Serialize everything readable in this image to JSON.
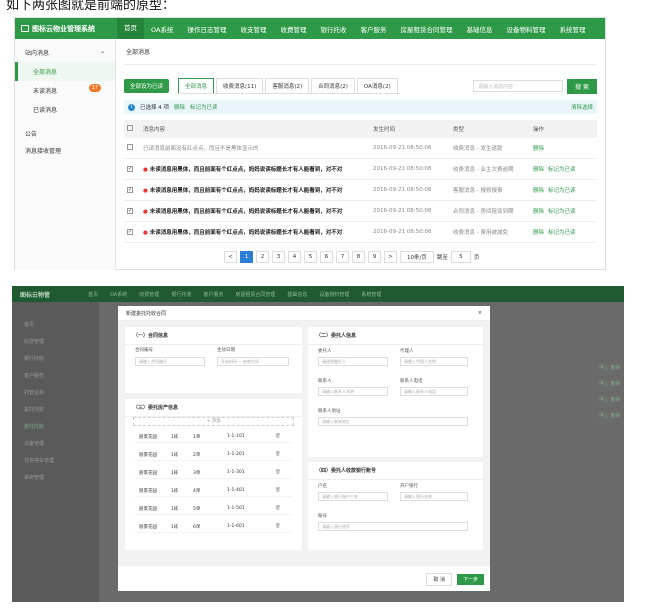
{
  "caption": "如下两张图就是前端的原型：",
  "top": {
    "brand": "图标云物业管理系统",
    "nav": [
      "首页",
      "OA系统",
      "操作日志管理",
      "收支管理",
      "收费管理",
      "银行托收",
      "客户服务",
      "房屋租赁合同管理",
      "基础信息",
      "设备物料管理",
      "系统管理"
    ],
    "sidebar": {
      "group1": "站内消息",
      "items": [
        {
          "label": "全部消息"
        },
        {
          "label": "未读消息",
          "badge": "17"
        },
        {
          "label": "已读消息"
        }
      ],
      "group2": "公告",
      "group3": "消息接收管理"
    },
    "breadcrumb": "全部消息",
    "mark_all_read": "全部设为已读",
    "tabs": [
      "全部消息",
      "收费消息(11)",
      "客服消息(2)",
      "合同消息(2)",
      "OA消息(2)"
    ],
    "search_placeholder": "请输入消息内容",
    "search_button": "搜 索",
    "info": {
      "selected": "已选择 4 项",
      "delete": "删除",
      "mark_read": "标记为已读",
      "clear": "清除选择"
    },
    "columns": [
      "消息内容",
      "发生时间",
      "类型",
      "操作"
    ],
    "rows": [
      {
        "content": "已读消息前面没有红点点，而且不是黑体显示的",
        "time": "2016-09-21  08:50:08",
        "type": "收费消息 - 发生退款",
        "ops": [
          "删除"
        ],
        "read": true,
        "checked": false
      },
      {
        "content": "未读消息用黑体，而且前面有个红点点，妈妈说读标题长才有人能看到，对不对",
        "time": "2016-09-21  08:50:08",
        "type": "收费消息 - 业主欠费逾期",
        "ops": [
          "删除",
          "标记为已读"
        ],
        "read": false,
        "checked": true
      },
      {
        "content": "未读消息用黑体，而且前面有个红点点，妈妈说读标题长才有人能看到，对不对",
        "time": "2016-09-21  08:50:08",
        "type": "客服消息 - 报修报事",
        "ops": [
          "删除",
          "标记为已读"
        ],
        "read": false,
        "checked": true
      },
      {
        "content": "未读消息用黑体，而且前面有个红点点，妈妈说读标题长才有人能看到，对不对",
        "time": "2016-09-21  08:50:08",
        "type": "合同消息 - 房间租赁到期",
        "ops": [
          "删除",
          "标记为已读"
        ],
        "read": false,
        "checked": true
      },
      {
        "content": "未读消息用黑体，而且前面有个红点点，妈妈说读标题长才有人能看到，对不对",
        "time": "2016-09-21  08:50:08",
        "type": "收费消息 - 费用被减免",
        "ops": [
          "删除",
          "标记为已读"
        ],
        "read": false,
        "checked": true
      }
    ],
    "pager": {
      "prev": "<",
      "pages": [
        "1",
        "2",
        "3",
        "4",
        "5",
        "6",
        "7",
        "8",
        "9"
      ],
      "next": ">",
      "per_page": "10条/页",
      "goto": "跳至",
      "page_input": "5",
      "page_suffix": "页"
    }
  },
  "bottom": {
    "brand": "图标云物管",
    "nav": [
      "首页",
      "OA系统",
      "收费管理",
      "银行托收",
      "客户服务",
      "房屋租赁合同管理",
      "基础信息",
      "设备物料管理",
      "系统管理"
    ],
    "sidebar": [
      "首页",
      "收费管理",
      "银行托收",
      "客户服务",
      "托管业务",
      "委托托收",
      "委托托收",
      "设备管理",
      "任务停车管理",
      "系统管理"
    ],
    "dim_ops": [
      "停止",
      "删除"
    ],
    "modal": {
      "title": "新建委托托收合同",
      "close": "×",
      "card1": {
        "title": "（一）合同信息",
        "contract_no_label": "合同编号",
        "contract_no_ph": "请输入合同编号",
        "sign_date_label": "生效日期",
        "sign_date_ph": "开始时间 ~ 结束时间"
      },
      "card2": {
        "title": "（二）委托人信息",
        "client_label": "委托人",
        "client_ph": "请选择委托人",
        "agent_label": "代理人",
        "agent_ph": "请输入代理人名称",
        "contact_label": "联系人",
        "contact_ph": "请输入联系人名称",
        "phone_label": "联系人电话",
        "phone_ph": "请输入联系人电话",
        "addr_label": "联系人地址",
        "addr_ph": "请输入联系地址"
      },
      "card3": {
        "title": "（三）委托房产信息",
        "add": "+ 添加",
        "rows": [
          {
            "area": "丽景花园",
            "building": "1栋",
            "unit": "1单",
            "room": "1-1-101"
          },
          {
            "area": "丽景花园",
            "building": "1栋",
            "unit": "2单",
            "room": "1-1-201"
          },
          {
            "area": "丽景花园",
            "building": "1栋",
            "unit": "3单",
            "room": "1-1-301"
          },
          {
            "area": "丽景花园",
            "building": "1栋",
            "unit": "4单",
            "room": "1-1-401"
          },
          {
            "area": "丽景花园",
            "building": "1栋",
            "unit": "5单",
            "room": "1-1-501"
          },
          {
            "area": "丽景花园",
            "building": "1栋",
            "unit": "6单",
            "room": "1-1-601"
          }
        ]
      },
      "card4": {
        "title": "（四）委托人收款银行账号",
        "account_name_label": "户名",
        "account_name_ph": "请输入银行账户户名",
        "bank_label": "开户银行",
        "bank_ph": "请输入银行名称",
        "account_no_label": "账号",
        "account_no_ph": "请输入银行账号"
      },
      "cancel": "取 消",
      "next": "下一步"
    }
  }
}
